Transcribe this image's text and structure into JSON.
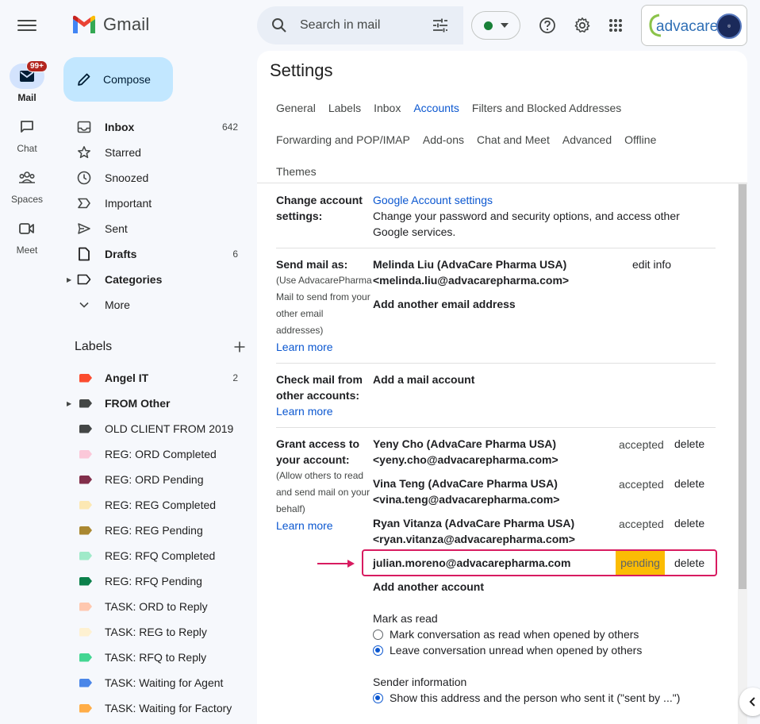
{
  "app": {
    "name": "Gmail"
  },
  "rail": {
    "items": [
      {
        "label": "Mail",
        "badge": "99+",
        "icon": "mail-icon",
        "active": true
      },
      {
        "label": "Chat",
        "icon": "chat-icon"
      },
      {
        "label": "Spaces",
        "icon": "spaces-icon"
      },
      {
        "label": "Meet",
        "icon": "meet-icon"
      }
    ]
  },
  "compose": {
    "label": "Compose"
  },
  "nav": {
    "items": [
      {
        "label": "Inbox",
        "count": "642",
        "icon": "inbox-icon",
        "bold": true
      },
      {
        "label": "Starred",
        "icon": "star-icon"
      },
      {
        "label": "Snoozed",
        "icon": "clock-icon"
      },
      {
        "label": "Important",
        "icon": "important-icon"
      },
      {
        "label": "Sent",
        "icon": "send-icon"
      },
      {
        "label": "Drafts",
        "count": "6",
        "icon": "draft-icon",
        "bold": true
      },
      {
        "label": "Categories",
        "icon": "label-outline-icon",
        "bold": true
      },
      {
        "label": "More",
        "icon": "chevron-down-icon"
      }
    ]
  },
  "labels": {
    "title": "Labels",
    "items": [
      {
        "label": "Angel IT",
        "count": "2",
        "color": "#fb4c2f",
        "bold": true
      },
      {
        "label": "FROM Other",
        "color": "#444746",
        "bold": true
      },
      {
        "label": "OLD CLIENT FROM 2019",
        "color": "#444746"
      },
      {
        "label": "REG: ORD Completed",
        "color": "#fbc8d9"
      },
      {
        "label": "REG: ORD Pending",
        "color": "#822f4b"
      },
      {
        "label": "REG: REG Completed",
        "color": "#fce8b3"
      },
      {
        "label": "REG: REG Pending",
        "color": "#aa8831"
      },
      {
        "label": "REG: RFQ Completed",
        "color": "#a0eac9"
      },
      {
        "label": "REG: RFQ Pending",
        "color": "#0b804b"
      },
      {
        "label": "TASK: ORD to Reply",
        "color": "#ffc8af"
      },
      {
        "label": "TASK: REG to Reply",
        "color": "#fef1d1"
      },
      {
        "label": "TASK: RFQ to Reply",
        "color": "#43d692"
      },
      {
        "label": "TASK: Waiting for Agent",
        "color": "#4a86e8"
      },
      {
        "label": "TASK: Waiting for Factory",
        "color": "#ffad47"
      }
    ]
  },
  "search": {
    "placeholder": "Search in mail"
  },
  "account": {
    "brand": "advacare"
  },
  "settings": {
    "title": "Settings",
    "tabs_row1": [
      "General",
      "Labels",
      "Inbox",
      "Accounts",
      "Filters and Blocked Addresses"
    ],
    "tabs_row2": [
      "Forwarding and POP/IMAP",
      "Add-ons",
      "Chat and Meet",
      "Advanced",
      "Offline"
    ],
    "tabs_row3": [
      "Themes"
    ],
    "active_tab": "Accounts",
    "change_account": {
      "label_l1": "Change account",
      "label_l2": "settings:",
      "link": "Google Account settings",
      "desc_l1": "Change your password and security options, and access other",
      "desc_l2": "Google services."
    },
    "send_mail": {
      "label": "Send mail as:",
      "sub_l1": "(Use AdvacarePharma",
      "sub_l2": "Mail to send from your",
      "sub_l3": "other email",
      "sub_l4": "addresses)",
      "learn_more": "Learn more",
      "name": "Melinda Liu (AdvaCare Pharma USA)",
      "email": "<melinda.liu@advacarepharma.com>",
      "edit": "edit info",
      "add": "Add another email address"
    },
    "check_mail": {
      "label_l1": "Check mail from",
      "label_l2": "other accounts:",
      "learn_more": "Learn more",
      "add": "Add a mail account"
    },
    "grant": {
      "label_l1": "Grant access to",
      "label_l2": "your account:",
      "sub_l1": "(Allow others to read",
      "sub_l2": "and send mail on your",
      "sub_l3": "behalf)",
      "learn_more": "Learn more",
      "delegates": [
        {
          "name": "Yeny Cho (AdvaCare Pharma USA)",
          "email": "<yeny.cho@advacarepharma.com>",
          "status": "accepted",
          "action": "delete"
        },
        {
          "name": "Vina Teng (AdvaCare Pharma USA)",
          "email": "<vina.teng@advacarepharma.com>",
          "status": "accepted",
          "action": "delete"
        },
        {
          "name": "Ryan Vitanza (AdvaCare Pharma USA)",
          "email": "<ryan.vitanza@advacarepharma.com>",
          "status": "accepted",
          "action": "delete"
        }
      ],
      "pending": {
        "email": "julian.moreno@advacarepharma.com",
        "status": "pending",
        "action": "delete"
      },
      "add": "Add another account",
      "mark_read": {
        "title": "Mark as read",
        "options": [
          {
            "label": "Mark conversation as read when opened by others",
            "selected": false
          },
          {
            "label": "Leave conversation unread when opened by others",
            "selected": true
          }
        ]
      },
      "sender_info": {
        "title": "Sender information",
        "options": [
          {
            "label": "Show this address and the person who sent it (\"sent by ...\")",
            "selected": true
          }
        ]
      }
    }
  },
  "colors": {
    "accent": "#0b57d0",
    "highlight": "#d81b60",
    "pending_bg": "#fbbc04"
  }
}
